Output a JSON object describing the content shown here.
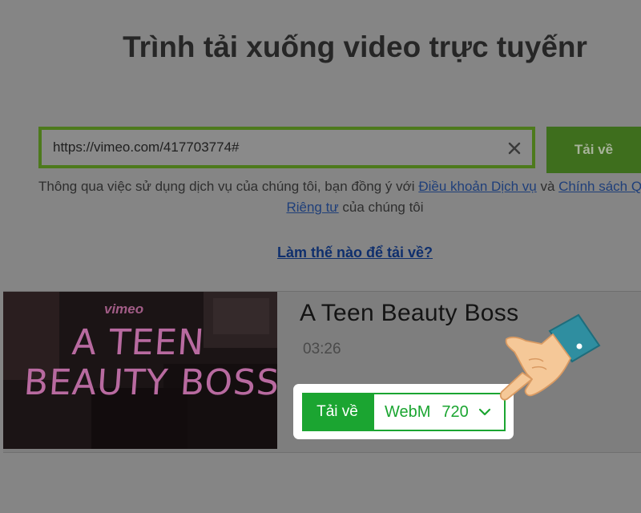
{
  "header": {
    "title": "Trình tải xuống video trực tuyếnr"
  },
  "search": {
    "url_value": "https://vimeo.com/417703774#",
    "submit_label": "Tải về"
  },
  "terms": {
    "prefix": "Thông qua việc sử dụng dịch vụ của chúng tôi, bạn đồng ý với ",
    "tos_link": "Điều khoản Dịch vụ",
    "and": " và ",
    "privacy_link_part1": "Chính sách Quyền",
    "privacy_link_part2": "Riêng tư",
    "suffix": " của chúng tôi"
  },
  "help_link": "Làm thế nào để tải về?",
  "result": {
    "thumbnail_brand": "vimeo",
    "thumbnail_line1": "A TEEN",
    "thumbnail_line2": "BEAUTY BOSS",
    "title": "A Teen Beauty Boss",
    "duration": "03:26",
    "download_label": "Tải về",
    "format": "WebM",
    "resolution": "720"
  },
  "icons": {
    "clear": "close-icon",
    "dropdown": "chevron-down-icon",
    "pointer": "pointing-hand-icon"
  },
  "colors": {
    "overlay_bg": "#858585",
    "accent_green": "#1ba531",
    "input_border": "#4d7a1c"
  }
}
